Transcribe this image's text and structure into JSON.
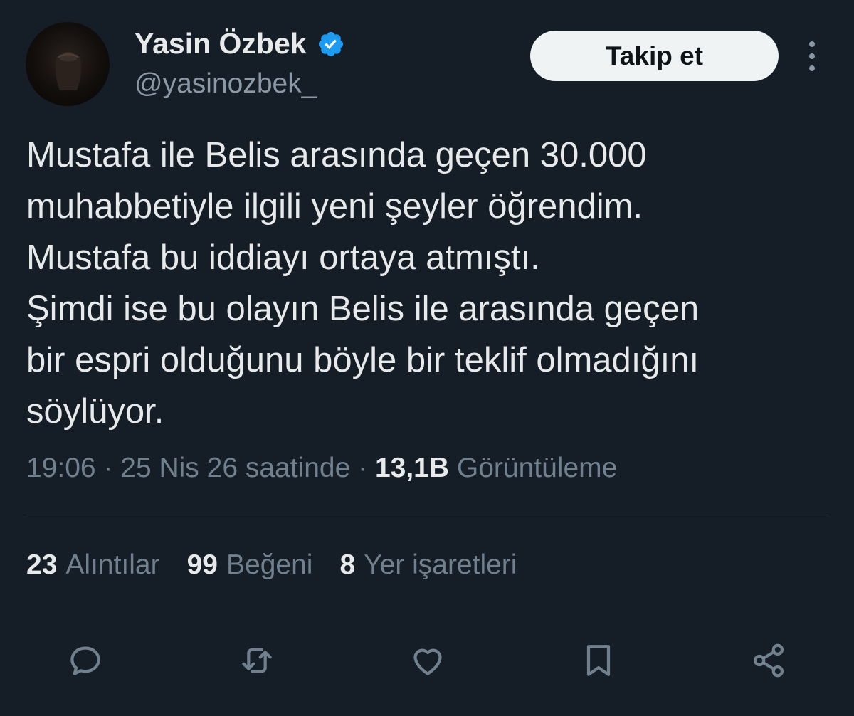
{
  "author": {
    "display_name": "Yasin Özbek",
    "handle": "@yasinozbek_",
    "verified_icon": "verified-badge-icon"
  },
  "follow_button": {
    "label": "Takip et"
  },
  "more_icon": "more-vertical-icon",
  "tweet": {
    "lines": [
      "Mustafa ile Belis arasında geçen 30.000",
      "muhabbetiyle ilgili yeni şeyler öğrendim.",
      "Mustafa bu iddiayı ortaya atmıştı.",
      "Şimdi ise bu olayın Belis ile arasında geçen",
      "bir espri olduğunu böyle bir teklif olmadığını",
      "söylüyor."
    ]
  },
  "meta": {
    "time_date": "19:06 · 25 Nis 26 saatinde · ",
    "views_count": "13,1B",
    "views_label": " Görüntüleme"
  },
  "stats": [
    {
      "count": "23",
      "label": "Alıntılar"
    },
    {
      "count": "99",
      "label": "Beğeni"
    },
    {
      "count": "8",
      "label": "Yer işaretleri"
    }
  ],
  "actions": [
    "reply-icon",
    "retweet-icon",
    "like-icon",
    "bookmark-icon",
    "share-icon"
  ],
  "colors": {
    "background": "#151d26",
    "text_primary": "#e7e9ea",
    "text_secondary": "#71808e",
    "verified": "#1d9bf0",
    "button_bg": "#eff3f4"
  }
}
